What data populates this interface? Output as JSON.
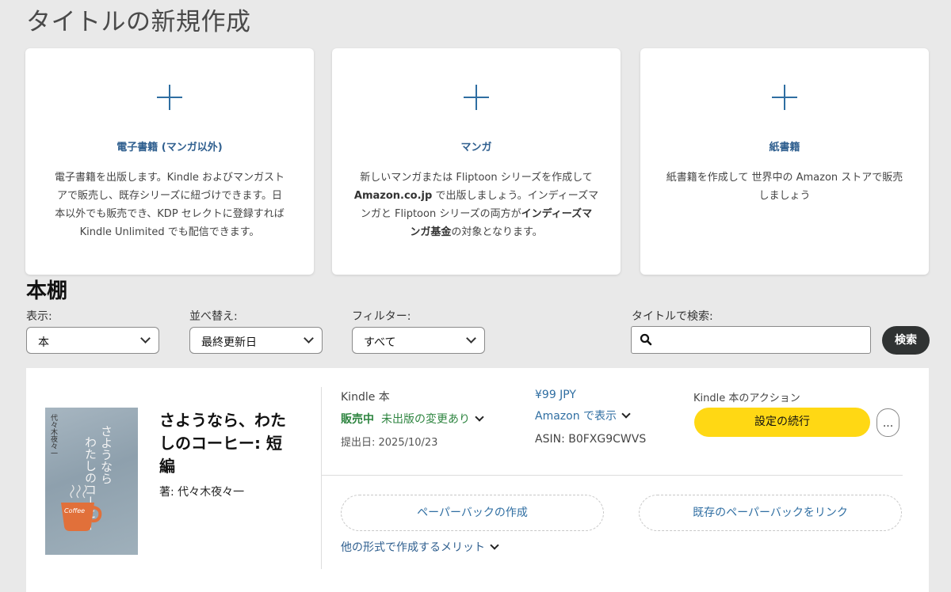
{
  "page": {
    "title": "タイトルの新規作成"
  },
  "create_cards": [
    {
      "title": "電子書籍 (マンガ以外)",
      "description_lines": [
        "電子書籍を出版します。Kindle およびマンガスト",
        "アで販売し、既存シリーズに紐づけできます。日",
        "本以外でも販売でき、KDP セレクトに登録すれば",
        "Kindle Unlimited でも配信できます。"
      ]
    },
    {
      "title": "マンガ",
      "desc": {
        "l1": "新しいマンガまたは Fliptoon シリーズを作成して",
        "l2_bold": "Amazon.co.jp",
        "l2_rest": " で出版しましょう。インディーズマ",
        "l3_pre": "ンガと Fliptoon シリーズの両方が",
        "l3_bold": "インディーズマ",
        "l4_bold": "ンガ基金",
        "l4_rest": "の対象となります。"
      }
    },
    {
      "title": "紙書籍",
      "description_lines": [
        "紙書籍を作成して 世界中の Amazon ストアで販売",
        "しましょう"
      ]
    }
  ],
  "bookshelf": {
    "title": "本棚",
    "filters": {
      "view_label": "表示:",
      "view_value": "本",
      "sort_label": "並べ替え:",
      "sort_value": "最終更新日",
      "filter_label": "フィルター:",
      "filter_value": "すべて",
      "search_label": "タイトルで検索:",
      "search_placeholder": "",
      "search_button": "検索"
    },
    "book": {
      "cover": {
        "title_line1": "さようなら",
        "title_line2": "わたしのコーヒー",
        "author": "代々木夜々一",
        "cup_text": "Coffee"
      },
      "title_lines": [
        "さようなら、わた",
        "しのコーヒー: 短",
        "編"
      ],
      "author": "著: 代々木夜々一",
      "format_label": "Kindle 本",
      "status_live": "販売中",
      "status_change": "未出版の変更あり",
      "submitted": "提出日: 2025/10/23",
      "price": "¥99 JPY",
      "view_on_amazon": "Amazon で表示",
      "asin": "ASIN: B0FXG9CWVS",
      "actions_label": "Kindle 本のアクション",
      "continue_button": "設定の続行",
      "more_button": "...",
      "create_paperback": "ペーパーバックの作成",
      "link_paperback": "既存のペーパーバックをリンク",
      "other_formats": "他の形式で作成するメリット"
    }
  },
  "colors": {
    "background": "#e9e9e9",
    "link_blue": "#2f6ea2",
    "status_green": "#2e8540",
    "primary_yellow": "#ffd814",
    "dark_button": "#303333"
  }
}
